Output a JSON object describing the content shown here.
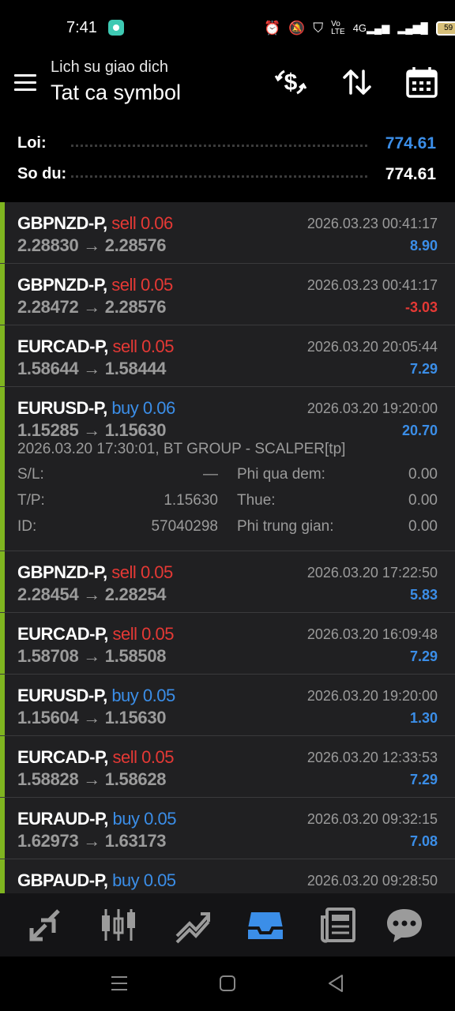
{
  "status": {
    "time": "7:41",
    "battery": "59",
    "network": "4G"
  },
  "header": {
    "subtitle": "Lich su giao dich",
    "title": "Tat ca symbol"
  },
  "summary": {
    "profit_label": "Loi:",
    "profit_value": "774.61",
    "balance_label": "So du:",
    "balance_value": "774.61"
  },
  "trades": [
    {
      "symbol": "GBPNZD-P,",
      "side": "sell",
      "volume": "0.06",
      "open": "2.28830",
      "close": "2.28576",
      "time": "2026.03.23 00:41:17",
      "profit": "8.90"
    },
    {
      "symbol": "GBPNZD-P,",
      "side": "sell",
      "volume": "0.05",
      "open": "2.28472",
      "close": "2.28576",
      "time": "2026.03.23 00:41:17",
      "profit": "-3.03"
    },
    {
      "symbol": "EURCAD-P,",
      "side": "sell",
      "volume": "0.05",
      "open": "1.58644",
      "close": "1.58444",
      "time": "2026.03.20 20:05:44",
      "profit": "7.29"
    },
    {
      "symbol": "EURUSD-P,",
      "side": "buy",
      "volume": "0.06",
      "open": "1.15285",
      "close": "1.15630",
      "time": "2026.03.20 19:20:00",
      "profit": "20.70"
    },
    {
      "symbol": "GBPNZD-P,",
      "side": "sell",
      "volume": "0.05",
      "open": "2.28454",
      "close": "2.28254",
      "time": "2026.03.20 17:22:50",
      "profit": "5.83"
    },
    {
      "symbol": "EURCAD-P,",
      "side": "sell",
      "volume": "0.05",
      "open": "1.58708",
      "close": "1.58508",
      "time": "2026.03.20 16:09:48",
      "profit": "7.29"
    },
    {
      "symbol": "EURUSD-P,",
      "side": "buy",
      "volume": "0.05",
      "open": "1.15604",
      "close": "1.15630",
      "time": "2026.03.20 19:20:00",
      "profit": "1.30"
    },
    {
      "symbol": "EURCAD-P,",
      "side": "sell",
      "volume": "0.05",
      "open": "1.58828",
      "close": "1.58628",
      "time": "2026.03.20 12:33:53",
      "profit": "7.29"
    },
    {
      "symbol": "EURAUD-P,",
      "side": "buy",
      "volume": "0.05",
      "open": "1.62973",
      "close": "1.63173",
      "time": "2026.03.20 09:32:15",
      "profit": "7.08"
    },
    {
      "symbol": "GBPAUD-P,",
      "side": "buy",
      "volume": "0.05",
      "open": "",
      "close": "",
      "time": "2026.03.20 09:28:50",
      "profit": ""
    }
  ],
  "detail": {
    "open_info": "2026.03.20 17:30:01, BT GROUP - SCALPER[tp]",
    "sl_label": "S/L:",
    "sl_value": "—",
    "tp_label": "T/P:",
    "tp_value": "1.15630",
    "id_label": "ID:",
    "id_value": "57040298",
    "swap_label": "Phi qua dem:",
    "swap_value": "0.00",
    "tax_label": "Thue:",
    "tax_value": "0.00",
    "commission_label": "Phi trung gian:",
    "commission_value": "0.00"
  },
  "nav": {
    "items": [
      "trade-icon",
      "chart-icon",
      "history-chart-icon",
      "history-inbox-icon",
      "news-icon",
      "chat-icon"
    ],
    "active_index": 3
  },
  "colors": {
    "sell": "#e53935",
    "buy": "#3b8ee8",
    "profit_positive": "#3b8ee8",
    "profit_negative": "#e53935",
    "row_marker": "#7fb520"
  }
}
